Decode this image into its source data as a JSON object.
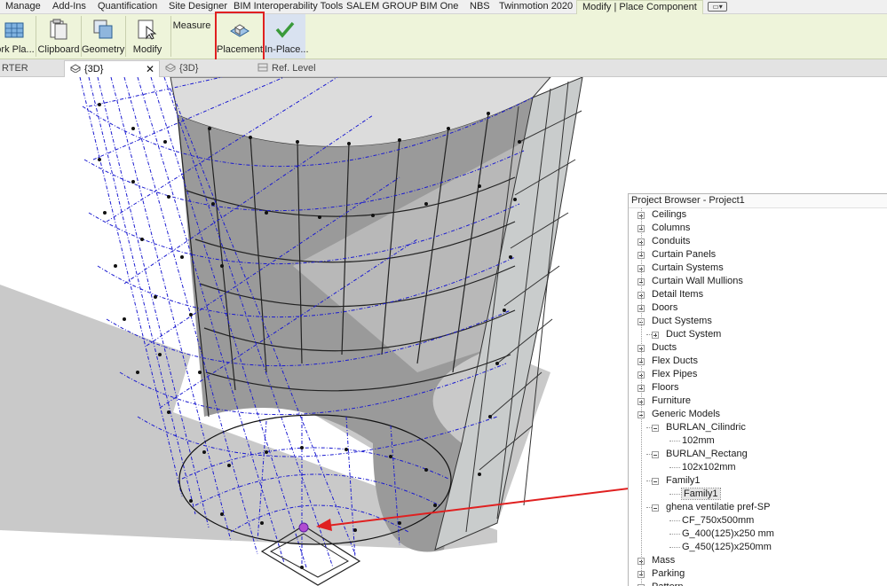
{
  "ribbon": {
    "tabs": [
      {
        "label": "Manage",
        "active": false
      },
      {
        "label": "Add-Ins",
        "active": false
      },
      {
        "label": "Quantification",
        "active": false
      },
      {
        "label": "Site Designer",
        "active": false
      },
      {
        "label": "BIM Interoperability Tools",
        "active": false
      },
      {
        "label": "SALEM GROUP",
        "active": false
      },
      {
        "label": "BIM One",
        "active": false
      },
      {
        "label": "NBS",
        "active": false
      },
      {
        "label": "Twinmotion 2020",
        "active": false
      },
      {
        "label": "Modify | Place Component",
        "active": true
      }
    ],
    "buttons": {
      "work_plane": "ork Pla...",
      "clipboard": "Clipboard",
      "geometry": "Geometry",
      "modify": "Modify",
      "measure": "Measure",
      "placement": "Placement",
      "in_place": "In-Place..."
    }
  },
  "view_tabs": [
    {
      "label": "RTER",
      "active": false
    },
    {
      "label": "{3D}",
      "active": true
    },
    {
      "label": "{3D}",
      "active": false
    },
    {
      "label": "Ref. Level",
      "active": false
    }
  ],
  "project_browser": {
    "title": "Project Browser - Project1",
    "items": [
      {
        "label": "Ceilings",
        "level": 0,
        "toggle": "plus"
      },
      {
        "label": "Columns",
        "level": 0,
        "toggle": "plus"
      },
      {
        "label": "Conduits",
        "level": 0,
        "toggle": "plus"
      },
      {
        "label": "Curtain Panels",
        "level": 0,
        "toggle": "plus"
      },
      {
        "label": "Curtain Systems",
        "level": 0,
        "toggle": "plus"
      },
      {
        "label": "Curtain Wall Mullions",
        "level": 0,
        "toggle": "plus"
      },
      {
        "label": "Detail Items",
        "level": 0,
        "toggle": "plus"
      },
      {
        "label": "Doors",
        "level": 0,
        "toggle": "plus"
      },
      {
        "label": "Duct Systems",
        "level": 0,
        "toggle": "minus"
      },
      {
        "label": "Duct System",
        "level": 1,
        "toggle": "plus"
      },
      {
        "label": "Ducts",
        "level": 0,
        "toggle": "plus"
      },
      {
        "label": "Flex Ducts",
        "level": 0,
        "toggle": "plus"
      },
      {
        "label": "Flex Pipes",
        "level": 0,
        "toggle": "plus"
      },
      {
        "label": "Floors",
        "level": 0,
        "toggle": "plus"
      },
      {
        "label": "Furniture",
        "level": 0,
        "toggle": "plus"
      },
      {
        "label": "Generic Models",
        "level": 0,
        "toggle": "minus"
      },
      {
        "label": "BURLAN_Cilindric",
        "level": 1,
        "toggle": "minus"
      },
      {
        "label": "102mm",
        "level": 2,
        "toggle": "none"
      },
      {
        "label": "BURLAN_Rectang",
        "level": 1,
        "toggle": "minus"
      },
      {
        "label": "102x102mm",
        "level": 2,
        "toggle": "none"
      },
      {
        "label": "Family1",
        "level": 1,
        "toggle": "minus"
      },
      {
        "label": "Family1",
        "level": 2,
        "toggle": "none",
        "selected": true
      },
      {
        "label": "ghena ventilatie pref-SP",
        "level": 1,
        "toggle": "minus"
      },
      {
        "label": "CF_750x500mm",
        "level": 2,
        "toggle": "none"
      },
      {
        "label": "G_400(125)x250 mm",
        "level": 2,
        "toggle": "none"
      },
      {
        "label": "G_450(125)x250mm",
        "level": 2,
        "toggle": "none"
      },
      {
        "label": "Mass",
        "level": 0,
        "toggle": "plus"
      },
      {
        "label": "Parking",
        "level": 0,
        "toggle": "plus"
      },
      {
        "label": "Pattern",
        "level": 0,
        "toggle": "plus"
      }
    ]
  },
  "colors": {
    "ribbon_active_bg": "#eef4da",
    "highlight": "#e02020",
    "grid_lines": "#1a1ad0",
    "arrow": "#e02020"
  },
  "icons": {
    "work_plane": "work-plane-icon",
    "clipboard": "clipboard-icon",
    "geometry": "geometry-icon",
    "modify": "modify-cursor-icon",
    "placement": "placement-icon",
    "in_place": "checkmark-icon"
  }
}
